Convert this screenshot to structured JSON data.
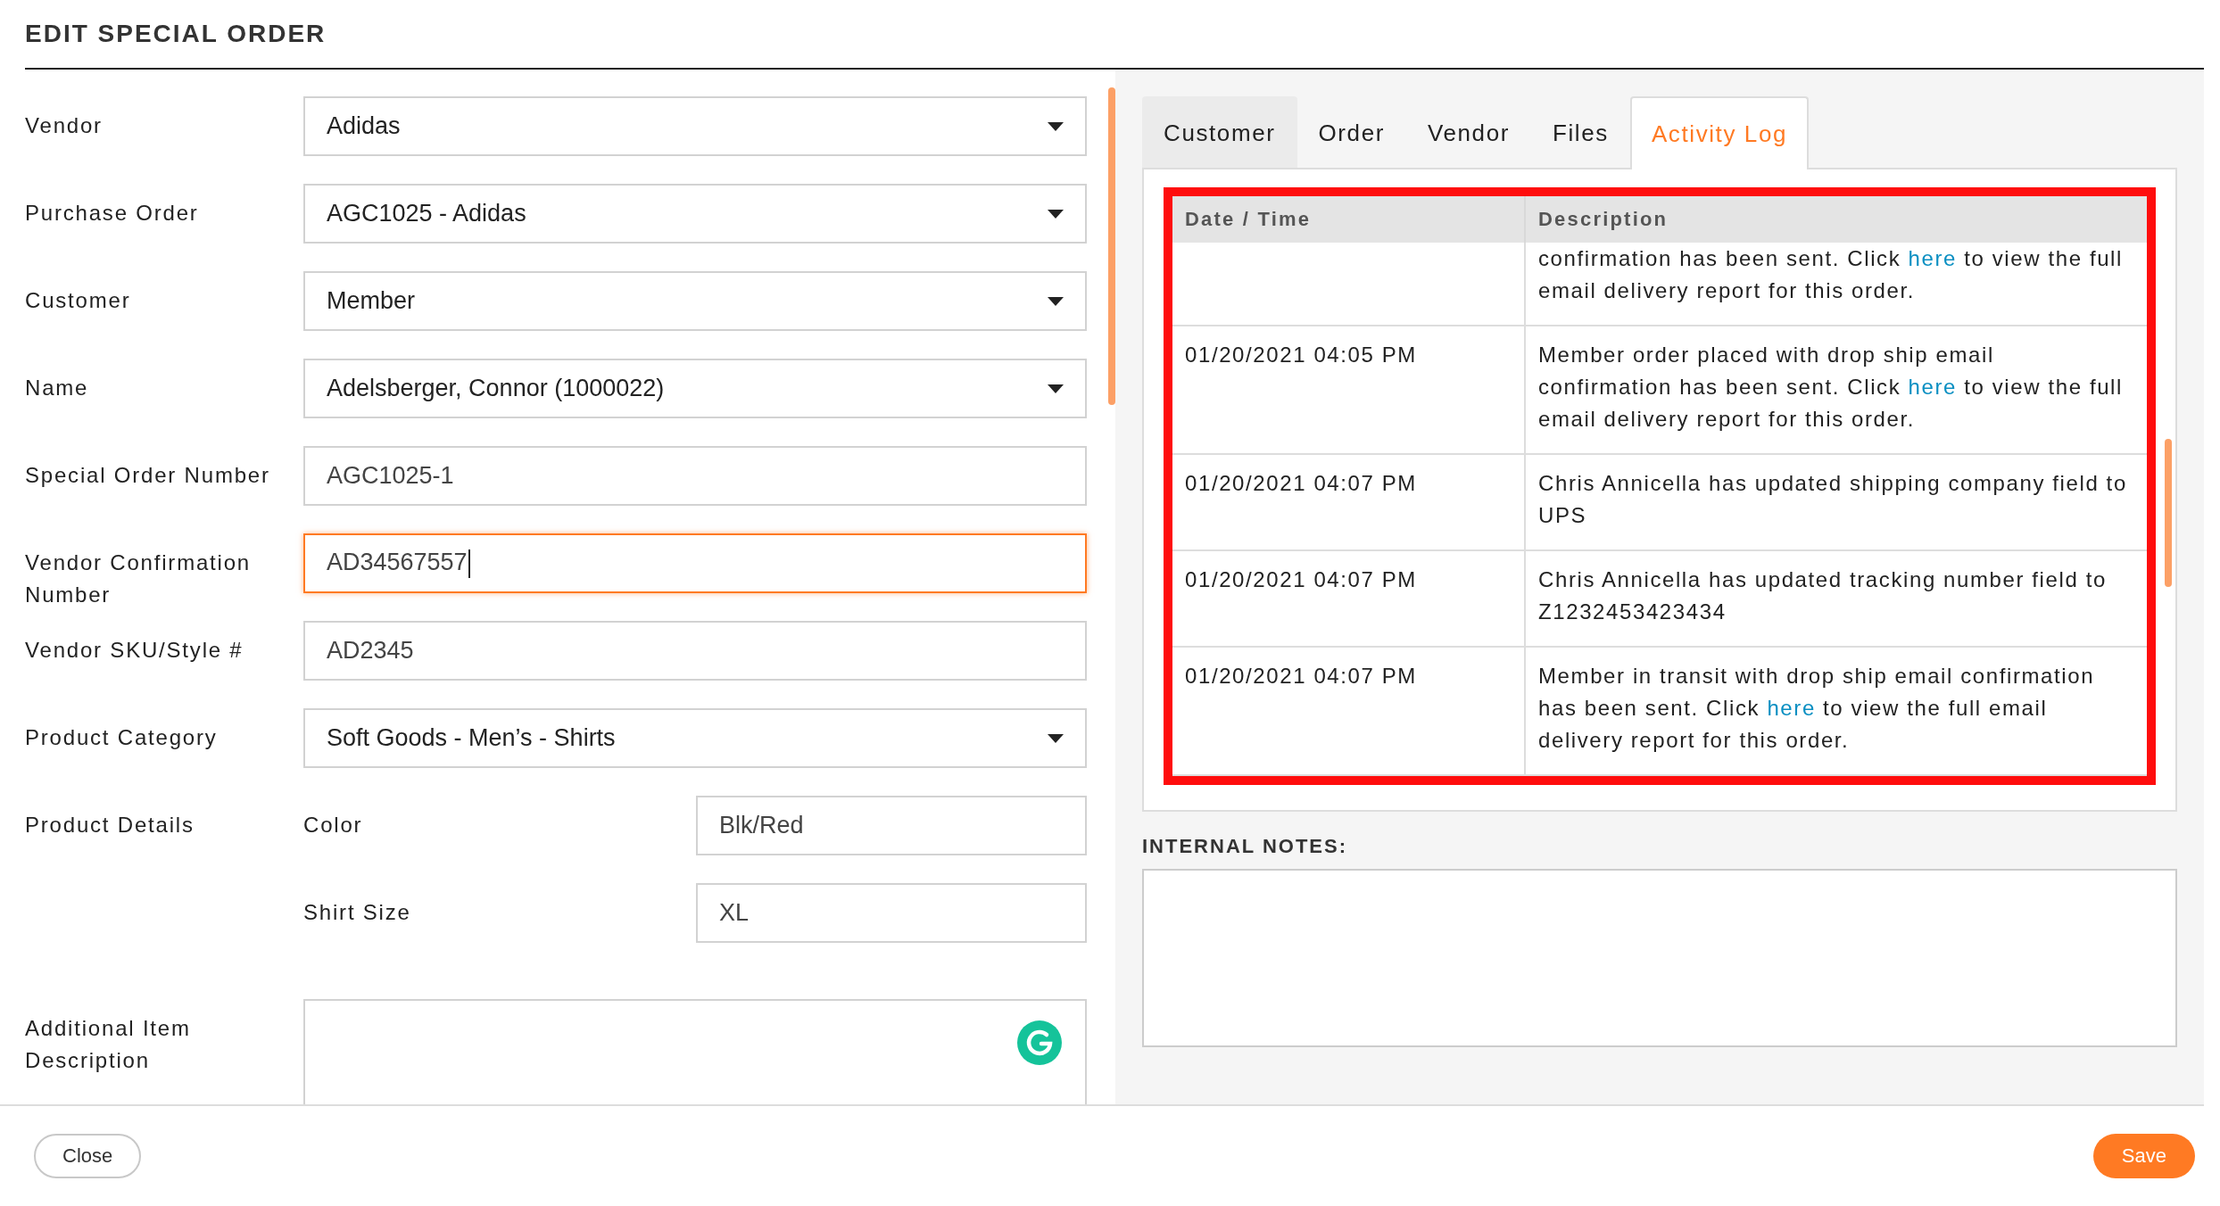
{
  "title": "EDIT SPECIAL ORDER",
  "form": {
    "fields": [
      {
        "label": "Vendor",
        "kind": "select",
        "value": "Adidas",
        "focused": false
      },
      {
        "label": "Purchase Order",
        "kind": "select",
        "value": "AGC1025 - Adidas",
        "focused": false
      },
      {
        "label": "Customer",
        "kind": "select",
        "value": "Member",
        "focused": false
      },
      {
        "label": "Name",
        "kind": "select",
        "value": "Adelsberger, Connor (1000022)",
        "focused": false
      },
      {
        "label": "Special Order Number",
        "kind": "text",
        "value": "AGC1025-1",
        "focused": false
      },
      {
        "label": "Vendor Confirmation Number",
        "kind": "text",
        "value": "AD34567557",
        "focused": true
      },
      {
        "label": "Vendor SKU/Style #",
        "kind": "text",
        "value": "AD2345",
        "focused": false
      },
      {
        "label": "Product Category",
        "kind": "select",
        "value": "Soft Goods - Men’s - Shirts",
        "focused": false
      },
      {
        "label": "Product Details",
        "kind": "details",
        "children": [
          {
            "label": "Color",
            "value": "Blk/Red",
            "focused": false
          },
          {
            "label": "Shirt Size",
            "value": "XL",
            "focused": false
          }
        ]
      },
      {
        "label": "Additional Item Description",
        "kind": "textarea",
        "focused": false
      }
    ]
  },
  "tabs": [
    {
      "label": "Customer",
      "selected": false
    },
    {
      "label": "Order",
      "selected": false
    },
    {
      "label": "Vendor",
      "selected": false
    },
    {
      "label": "Files",
      "selected": false
    },
    {
      "label": "Activity Log",
      "selected": true
    }
  ],
  "activity_log": {
    "columns": [
      "Date / Time",
      "Description"
    ],
    "rows": [
      {
        "description": {
          "before": "confirmation has been sent. Click ",
          "link": "here",
          "after": " to view the full email delivery report for this order."
        }
      },
      {
        "date_time": "01/20/2021 04:05 PM",
        "description": {
          "before": "Member order placed with drop ship email confirmation has been sent. Click ",
          "link": "here",
          "after": " to view the full email delivery report for this order."
        }
      },
      {
        "date_time": "01/20/2021 04:07 PM",
        "description": {
          "before": "Chris Annicella has updated shipping company field to UPS"
        }
      },
      {
        "date_time": "01/20/2021 04:07 PM",
        "description": {
          "before": "Chris Annicella has updated tracking number field to Z1232453423434"
        }
      },
      {
        "date_time": "01/20/2021 04:07 PM",
        "description": {
          "before": "Member in transit with drop ship email confirmation has been sent. Click ",
          "link": "here",
          "after": " to view the full email delivery report for this order."
        }
      }
    ]
  },
  "internal_notes": {
    "label": "INTERNAL NOTES:"
  },
  "buttons": [
    {
      "label": "Close",
      "kind": "secondary"
    },
    {
      "label": "Save",
      "kind": "primary"
    }
  ]
}
